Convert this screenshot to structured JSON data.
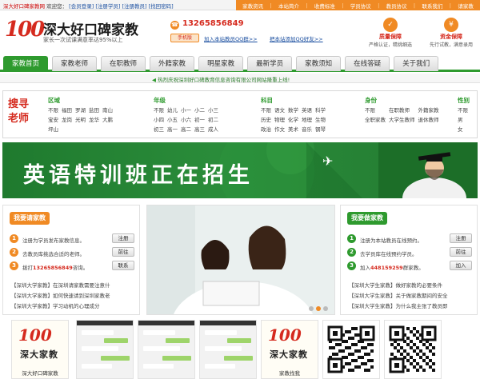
{
  "topbar": {
    "site": "深大好口碑家教网",
    "welcome": "欢迎您：",
    "links": [
      "[会员登录]",
      "[注册学员]",
      "[注册教员]",
      "[找回密码]"
    ],
    "menu": [
      "家教资讯",
      "本站简介",
      "收费标准",
      "学员协议",
      "教员协议",
      "联系我们",
      "请家教"
    ]
  },
  "header": {
    "logo_num": "100",
    "title": "深大好口碑家教",
    "slogan": "家长一次试课满意率达95%以上",
    "phone": "13265856849",
    "mobile_label": "手机版",
    "qq_group_1": "加入本站教员QQ群>>",
    "qq_group_2": "把本站添加QQ好友>>",
    "guarantees": [
      {
        "title": "质量保障",
        "sub": "严格认证，精挑细选"
      },
      {
        "title": "资金保障",
        "sub": "先行试教，满意录用"
      }
    ]
  },
  "nav": {
    "tabs": [
      "家教首页",
      "家教老师",
      "在职教师",
      "外籍家教",
      "明星家教",
      "最新学员",
      "家教须知",
      "在线答疑",
      "关于我们"
    ],
    "active": 0
  },
  "notice": "热烈庆祝深圳好口碑教育信息咨询有限公司网站隆重上线!",
  "search": {
    "title": "搜寻老师",
    "region": {
      "label": "区域",
      "items": [
        "不限",
        "福田",
        "罗湖",
        "盐田",
        "南山",
        "宝安",
        "龙岗",
        "光明",
        "龙华",
        "大鹏",
        "坪山"
      ]
    },
    "grade": {
      "label": "年级",
      "items": [
        "不限",
        "幼儿",
        "小一",
        "小二",
        "小三",
        "小四",
        "小五",
        "小六",
        "初一",
        "初二",
        "初三",
        "高一",
        "高二",
        "高三",
        "成人"
      ]
    },
    "subject": {
      "label": "科目",
      "items": [
        "不限",
        "语文",
        "数学",
        "英语",
        "科学",
        "历史",
        "物理",
        "化学",
        "地理",
        "生物",
        "政治",
        "作文",
        "美术",
        "音乐",
        "钢琴"
      ]
    },
    "identity": {
      "label": "身份",
      "items": [
        "不限",
        "在职教师",
        "外籍家教",
        "全职家教",
        "大学生教师",
        "退休教师"
      ]
    },
    "gender": {
      "label": "性别",
      "items": [
        "不限",
        "男",
        "女"
      ]
    }
  },
  "banner": {
    "text": "英语特训班正在招生"
  },
  "left_panel": {
    "title": "我要请家教",
    "steps": [
      {
        "n": "1",
        "text": "注册为学员发布家教信息。",
        "btn": "注册"
      },
      {
        "n": "2",
        "text": "去教员库挑选合适的老师。",
        "btn": "前往"
      },
      {
        "n": "3",
        "text": "拨打",
        "highlight": "13265856849",
        "tail": "咨询。",
        "btn": "联系"
      }
    ],
    "news": [
      "【深圳大学家教】在深圳请家教需要注意什",
      "【深圳大学家教】如何快速请到深圳家教老",
      "【深圳大学家教】学习动机的心理成分"
    ]
  },
  "right_panel": {
    "title": "我要做家教",
    "steps": [
      {
        "n": "1",
        "text": "注册为本站教员在线预约。",
        "btn": "注册"
      },
      {
        "n": "2",
        "text": "去学员库在线预约学员。",
        "btn": "前往"
      },
      {
        "n": "3",
        "text": "加入",
        "highlight": "448159259",
        "tail": "群家教。",
        "btn": "加入"
      }
    ],
    "news": [
      "【深圳大学生家教】做好家教的必要条件",
      "【深圳大学生家教】关于做家教期间的安全",
      "【深圳大学生家教】为什么我主张了教员即"
    ]
  },
  "thumbs": [
    {
      "type": "logo",
      "num": "100",
      "t": "深大家教",
      "cap": "深大好口碑家教"
    },
    {
      "type": "chat",
      "cap": ""
    },
    {
      "type": "chat",
      "cap": ""
    },
    {
      "type": "chat",
      "cap": ""
    },
    {
      "type": "logo",
      "num": "100",
      "t": "深大家教",
      "cap": "家教找我"
    },
    {
      "type": "qr",
      "cap": ""
    },
    {
      "type": "qr",
      "cap": ""
    }
  ],
  "colors": {
    "orange": "#f08a24",
    "green": "#2e9a2e",
    "red": "#d52a1e"
  }
}
